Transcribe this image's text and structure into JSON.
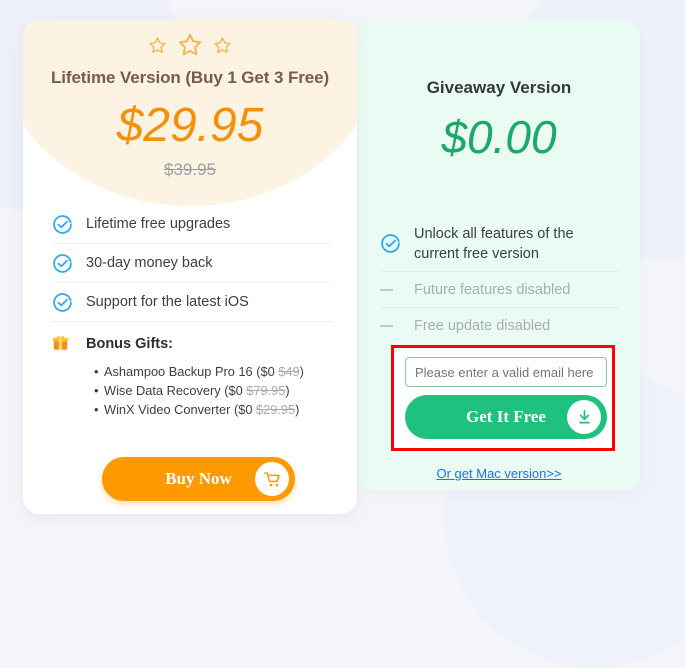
{
  "colors": {
    "page_bg": "#f4f5f9",
    "cream": "#fdf3e2",
    "orange": "#f90",
    "orange_price": "#f79009",
    "mint": "#eafbf3",
    "green": "#1fc17f",
    "green_price": "#1aa86b",
    "check_blue": "#2aa8f2",
    "highlight_red": "#fe0000",
    "link_blue": "#1a73e8"
  },
  "lifetime": {
    "stars_icon": "star-outline-icon",
    "title": "Lifetime Version (Buy 1 Get 3 Free)",
    "price": "$29.95",
    "price_original": "$39.95",
    "features": [
      {
        "icon": "circle-check-icon",
        "label": "Lifetime free upgrades"
      },
      {
        "icon": "circle-check-icon",
        "label": "30-day money back"
      },
      {
        "icon": "circle-check-icon",
        "label": "Support for the latest iOS"
      }
    ],
    "bonus": {
      "icon": "gift-icon",
      "title": "Bonus Gifts:",
      "items": [
        {
          "name": "Ashampoo Backup Pro 16",
          "free_price": "($0",
          "original_price": "$49",
          "close": ")"
        },
        {
          "name": "Wise Data Recovery",
          "free_price": "($0",
          "original_price": "$79.95",
          "close": ")"
        },
        {
          "name": "WinX Video Converter",
          "free_price": "($0",
          "original_price": "$29.95",
          "close": ")"
        }
      ]
    },
    "buy_button": {
      "label": "Buy Now",
      "icon": "shopping-cart-icon"
    }
  },
  "giveaway": {
    "title": "Giveaway Version",
    "price": "$0.00",
    "features": [
      {
        "icon": "circle-check-icon",
        "label": "Unlock all features of the current free version",
        "disabled": false
      },
      {
        "icon": "dash-icon",
        "label": "Future features disabled",
        "disabled": true
      },
      {
        "icon": "dash-icon",
        "label": "Free update disabled",
        "disabled": true
      }
    ],
    "email_input": {
      "placeholder": "Please enter a valid email here",
      "value": ""
    },
    "get_button": {
      "label": "Get It Free",
      "icon": "download-icon"
    },
    "mac_link": "Or get Mac version>>"
  }
}
